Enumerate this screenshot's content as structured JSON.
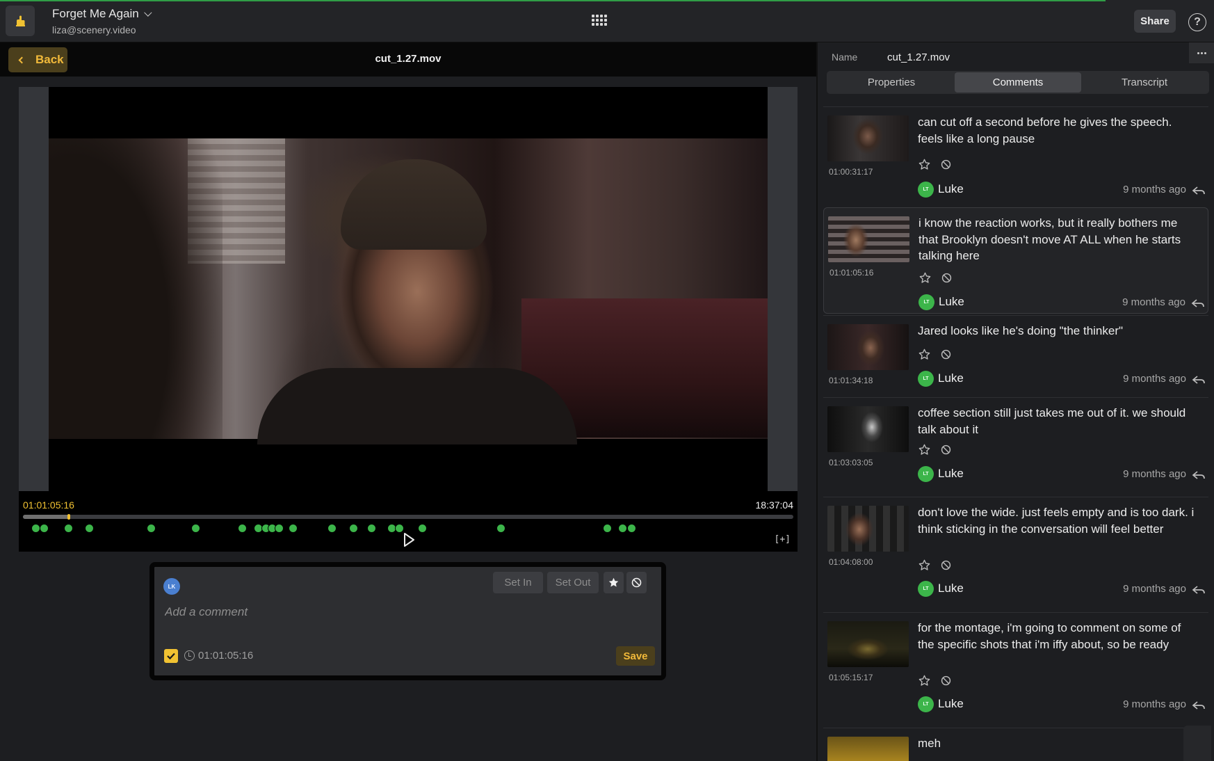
{
  "app": {
    "project_title": "Forget Me Again",
    "account_email": "liza@scenery.video",
    "share_label": "Share",
    "help_label": "?"
  },
  "player": {
    "back_label": "Back",
    "file_name": "cut_1.27.mov",
    "current_timecode": "01:01:05:16",
    "duration": "18:37:04",
    "fullscreen_label": "[+]",
    "playhead_fraction": 0.06,
    "comment_markers": [
      0.016,
      0.027,
      0.059,
      0.086,
      0.166,
      0.224,
      0.284,
      0.305,
      0.315,
      0.323,
      0.332,
      0.35,
      0.401,
      0.429,
      0.452,
      0.478,
      0.488,
      0.518,
      0.62,
      0.758,
      0.778,
      0.79
    ]
  },
  "composer": {
    "avatar_initials": "LK",
    "set_in_label": "Set In",
    "set_out_label": "Set Out",
    "placeholder": "Add a comment",
    "timecode": "01:01:05:16",
    "save_label": "Save",
    "accent_color": "#f1c232"
  },
  "inspector": {
    "name_label": "Name",
    "name_value": "cut_1.27.mov",
    "tabs": [
      {
        "label": "Properties"
      },
      {
        "label": "Comments"
      },
      {
        "label": "Transcript"
      }
    ],
    "active_tab": "Comments"
  },
  "comments": [
    {
      "timecode": "01:00:31:17",
      "text": "can cut off a second before he gives the speech. feels like a long pause",
      "user": "Luke",
      "initials": "LT",
      "time": "9 months ago"
    },
    {
      "timecode": "01:01:05:16",
      "text": "i know the reaction works, but it really bothers me that Brooklyn doesn't move AT ALL when he starts talking here",
      "user": "Luke",
      "initials": "LT",
      "time": "9 months ago"
    },
    {
      "timecode": "01:01:34:18",
      "text": "Jared looks like he's doing \"the thinker\"",
      "user": "Luke",
      "initials": "LT",
      "time": "9 months ago"
    },
    {
      "timecode": "01:03:03:05",
      "text": "coffee section still just takes me out of it. we should talk about it",
      "user": "Luke",
      "initials": "LT",
      "time": "9 months ago"
    },
    {
      "timecode": "01:04:08:00",
      "text": "don't love the wide. just feels empty and is too dark. i think sticking in the conversation will feel better",
      "user": "Luke",
      "initials": "LT",
      "time": "9 months ago"
    },
    {
      "timecode": "01:05:15:17",
      "text": "for the montage, i'm going to comment on some of the specific shots that i'm iffy about, so be ready",
      "user": "Luke",
      "initials": "LT",
      "time": "9 months ago"
    },
    {
      "text": "meh"
    }
  ],
  "colors": {
    "marker": "#3cb54a",
    "accent": "#f1c232",
    "user_avatar": "#3cb54a"
  }
}
